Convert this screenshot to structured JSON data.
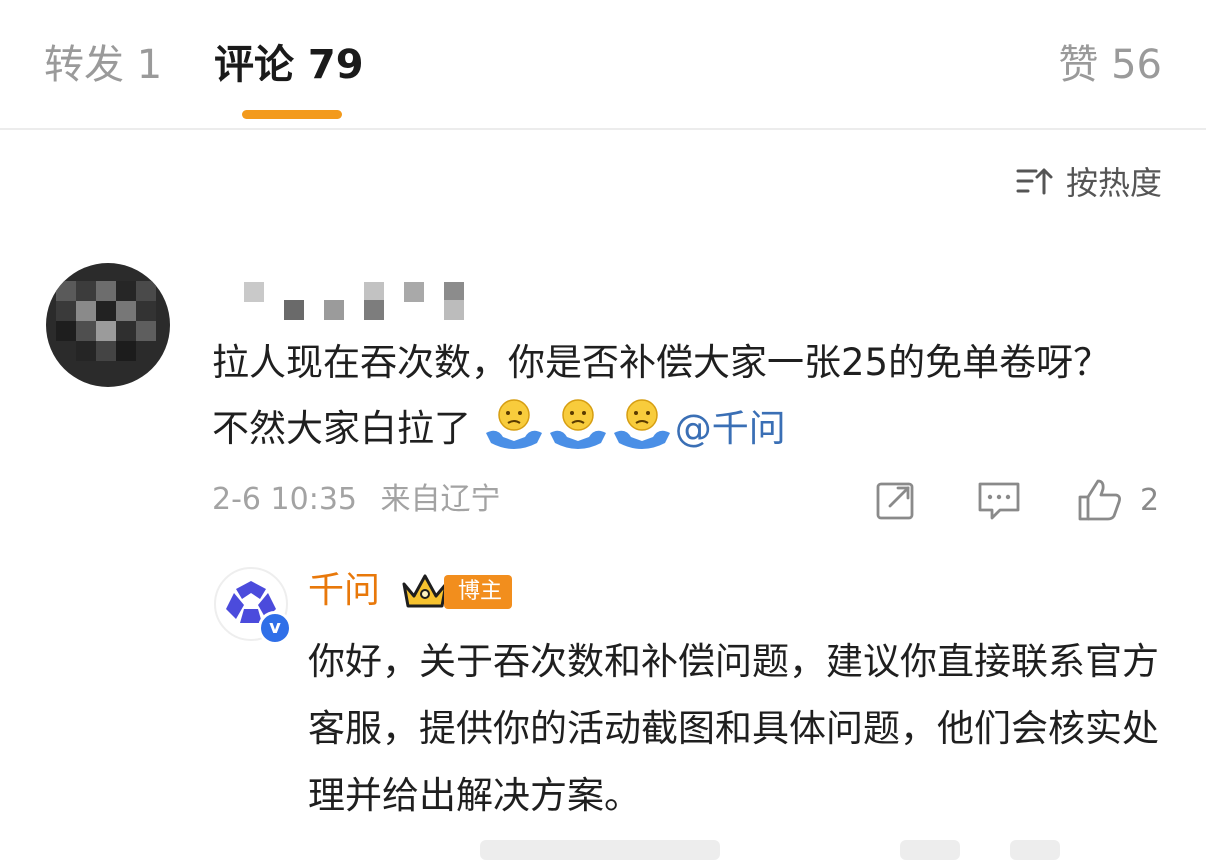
{
  "tabs": {
    "repost": "转发 1",
    "comments": "评论 79",
    "likes": "赞 56"
  },
  "sort": {
    "label": "按热度"
  },
  "comment": {
    "text": "拉人现在吞次数，你是否补偿大家一张25的免单卷呀？不然大家白拉了",
    "mention": "@千问",
    "date": "2-6 10:35",
    "location": "来自辽宁",
    "likes": "2"
  },
  "reply": {
    "author": "千问",
    "badge": "博主",
    "text": "你好，关于吞次数和补偿问题，建议你直接联系官方客服，提供你的活动截图和具体问题，他们会核实处理并给出解决方案。"
  },
  "icons": {
    "sort": "sort-icon",
    "repost": "repost-icon",
    "comment": "comment-icon",
    "like": "like-icon",
    "emoji": "shrug-emoji-icon",
    "crown": "crown-icon",
    "verified": "verified-icon"
  },
  "colors": {
    "accent": "#f39a1c",
    "author": "#e8780a",
    "badge": "#f28e1d",
    "mention": "#3a6fb5",
    "verified": "#2f6fe8"
  }
}
